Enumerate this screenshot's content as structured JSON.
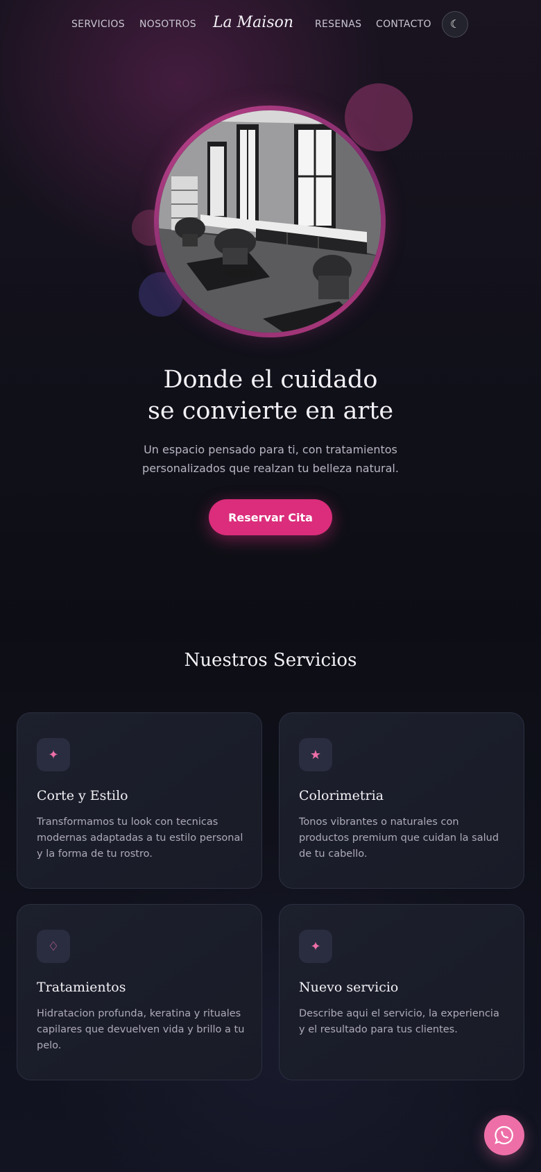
{
  "nav": {
    "links": [
      "SERVICIOS",
      "NOSOTROS",
      "RESENAS",
      "CONTACTO"
    ],
    "brand": "La Maison",
    "theme_toggle_icon": "☾"
  },
  "hero": {
    "title_line1": "Donde el cuidado",
    "title_line2": "se convierte en arte",
    "subtitle": "Un espacio pensado para ti, con tratamientos personalizados que realzan tu belleza natural.",
    "cta_label": "Reservar Cita"
  },
  "services": {
    "title": "Nuestros Servicios",
    "cards": [
      {
        "icon": "✦",
        "icon_name": "sparkle-icon",
        "title": "Corte y Estilo",
        "description": "Transformamos tu look con tecnicas modernas adaptadas a tu estilo personal y la forma de tu rostro."
      },
      {
        "icon": "★",
        "icon_name": "star-icon",
        "title": "Colorimetria",
        "description": "Tonos vibrantes o naturales con productos premium que cuidan la salud de tu cabello."
      },
      {
        "icon": "♢",
        "icon_name": "diamond-icon",
        "title": "Tratamientos",
        "description": "Hidratacion profunda, keratina y rituales capilares que devuelven vida y brillo a tu pelo."
      },
      {
        "icon": "✦",
        "icon_name": "sparkle-icon",
        "title": "Nuevo servicio",
        "description": "Describe aqui el servicio, la experiencia y el resultado para tus clientes."
      }
    ]
  },
  "colors": {
    "accent": "#db2d7b",
    "accent_light": "#ee6fa8",
    "background": "#0d0e15",
    "card": "#1c1f2c"
  },
  "floating": {
    "whatsapp_icon": "whatsapp-icon"
  }
}
